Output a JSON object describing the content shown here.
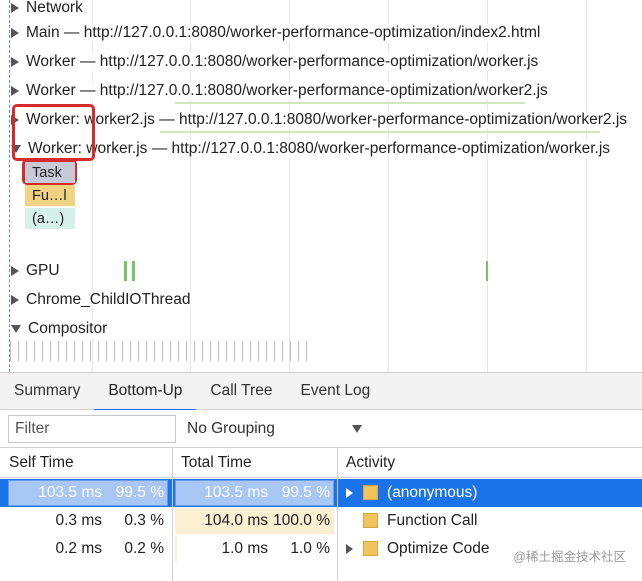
{
  "timeline": {
    "tracks": [
      {
        "id": "network",
        "label": "Network",
        "expanded": false
      },
      {
        "id": "main",
        "label": "Main — http://127.0.0.1:8080/worker-performance-optimization/index2.html",
        "expanded": false
      },
      {
        "id": "worker1",
        "label": "Worker — http://127.0.0.1:8080/worker-performance-optimization/worker.js",
        "expanded": false
      },
      {
        "id": "worker2",
        "label": "Worker — http://127.0.0.1:8080/worker-performance-optimization/worker2.js",
        "expanded": false
      },
      {
        "id": "worker3",
        "label": "Worker: worker2.js — http://127.0.0.1:8080/worker-performance-optimization/worker2.js",
        "expanded": false
      },
      {
        "id": "worker4",
        "label": "Worker: worker.js — http://127.0.0.1:8080/worker-performance-optimization/worker.js",
        "expanded": true
      },
      {
        "id": "gpu",
        "label": "GPU",
        "expanded": false
      },
      {
        "id": "chrome-io",
        "label": "Chrome_ChildIOThread",
        "expanded": false
      },
      {
        "id": "compositor",
        "label": "Compositor",
        "expanded": true
      }
    ],
    "flames": {
      "task": "Task",
      "function_call": "Fu…l",
      "anonymous": "(a…)"
    }
  },
  "panel": {
    "tabs": [
      {
        "label": "Summary",
        "active": false
      },
      {
        "label": "Bottom-Up",
        "active": true
      },
      {
        "label": "Call Tree",
        "active": false
      },
      {
        "label": "Event Log",
        "active": false
      }
    ],
    "filter_placeholder": "Filter",
    "grouping": "No Grouping",
    "columns": {
      "self_time": "Self Time",
      "total_time": "Total Time",
      "activity": "Activity"
    },
    "rows": [
      {
        "self_time": "103.5 ms",
        "self_pct": "99.5 %",
        "total_time": "103.5 ms",
        "total_pct": "99.5 %",
        "activity": "(anonymous)",
        "expandable": true,
        "selected": true,
        "total_fraction": 0.995
      },
      {
        "self_time": "0.3 ms",
        "self_pct": "0.3 %",
        "total_time": "104.0 ms",
        "total_pct": "100.0 %",
        "activity": "Function Call",
        "expandable": false,
        "selected": false,
        "total_fraction": 1.0
      },
      {
        "self_time": "0.2 ms",
        "self_pct": "0.2 %",
        "total_time": "1.0 ms",
        "total_pct": "1.0 %",
        "activity": "Optimize Code",
        "expandable": true,
        "selected": false,
        "total_fraction": 0.01
      }
    ],
    "watermark": "@稀土掘金技术社区"
  },
  "colors": {
    "accent": "#1a73e8",
    "highlight_box": "#d62b2b",
    "task": "#c8c9d9",
    "function_call": "#f0d483",
    "anonymous": "#d6f0ea",
    "activity_square": "#f1c45e"
  }
}
